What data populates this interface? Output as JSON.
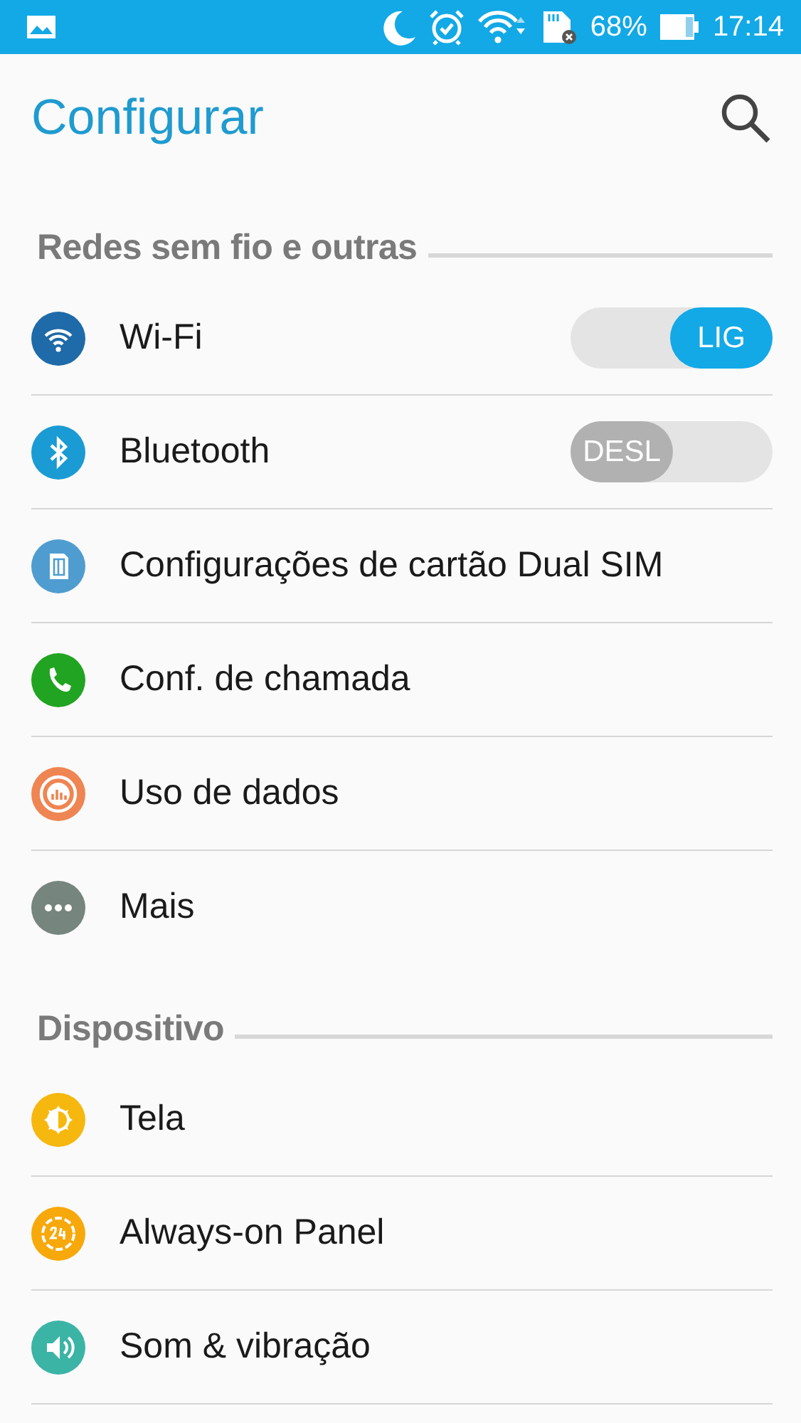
{
  "status_bar": {
    "battery": "68%",
    "time": "17:14"
  },
  "header": {
    "title": "Configurar"
  },
  "sections": [
    {
      "title": "Redes sem fio e outras",
      "items": [
        {
          "label": "Wi-Fi",
          "kind": "toggle",
          "on": true,
          "state_label": "LIG",
          "color": "#1f6aa8"
        },
        {
          "label": "Bluetooth",
          "kind": "toggle",
          "on": false,
          "state_label": "DESL",
          "color": "#1a9bd3"
        },
        {
          "label": "Configurações de cartão Dual SIM",
          "kind": "link",
          "color": "#4f9dd0"
        },
        {
          "label": "Conf. de chamada",
          "kind": "link",
          "color": "#21a421"
        },
        {
          "label": "Uso de dados",
          "kind": "link",
          "color": "#ef8552"
        },
        {
          "label": "Mais",
          "kind": "link",
          "color": "#76857d"
        }
      ]
    },
    {
      "title": "Dispositivo",
      "items": [
        {
          "label": "Tela",
          "kind": "link",
          "color": "#f6b80f"
        },
        {
          "label": "Always-on Panel",
          "kind": "link",
          "color": "#f7a80b"
        },
        {
          "label": "Som & vibração",
          "kind": "link",
          "color": "#3bb4a6"
        }
      ]
    }
  ]
}
